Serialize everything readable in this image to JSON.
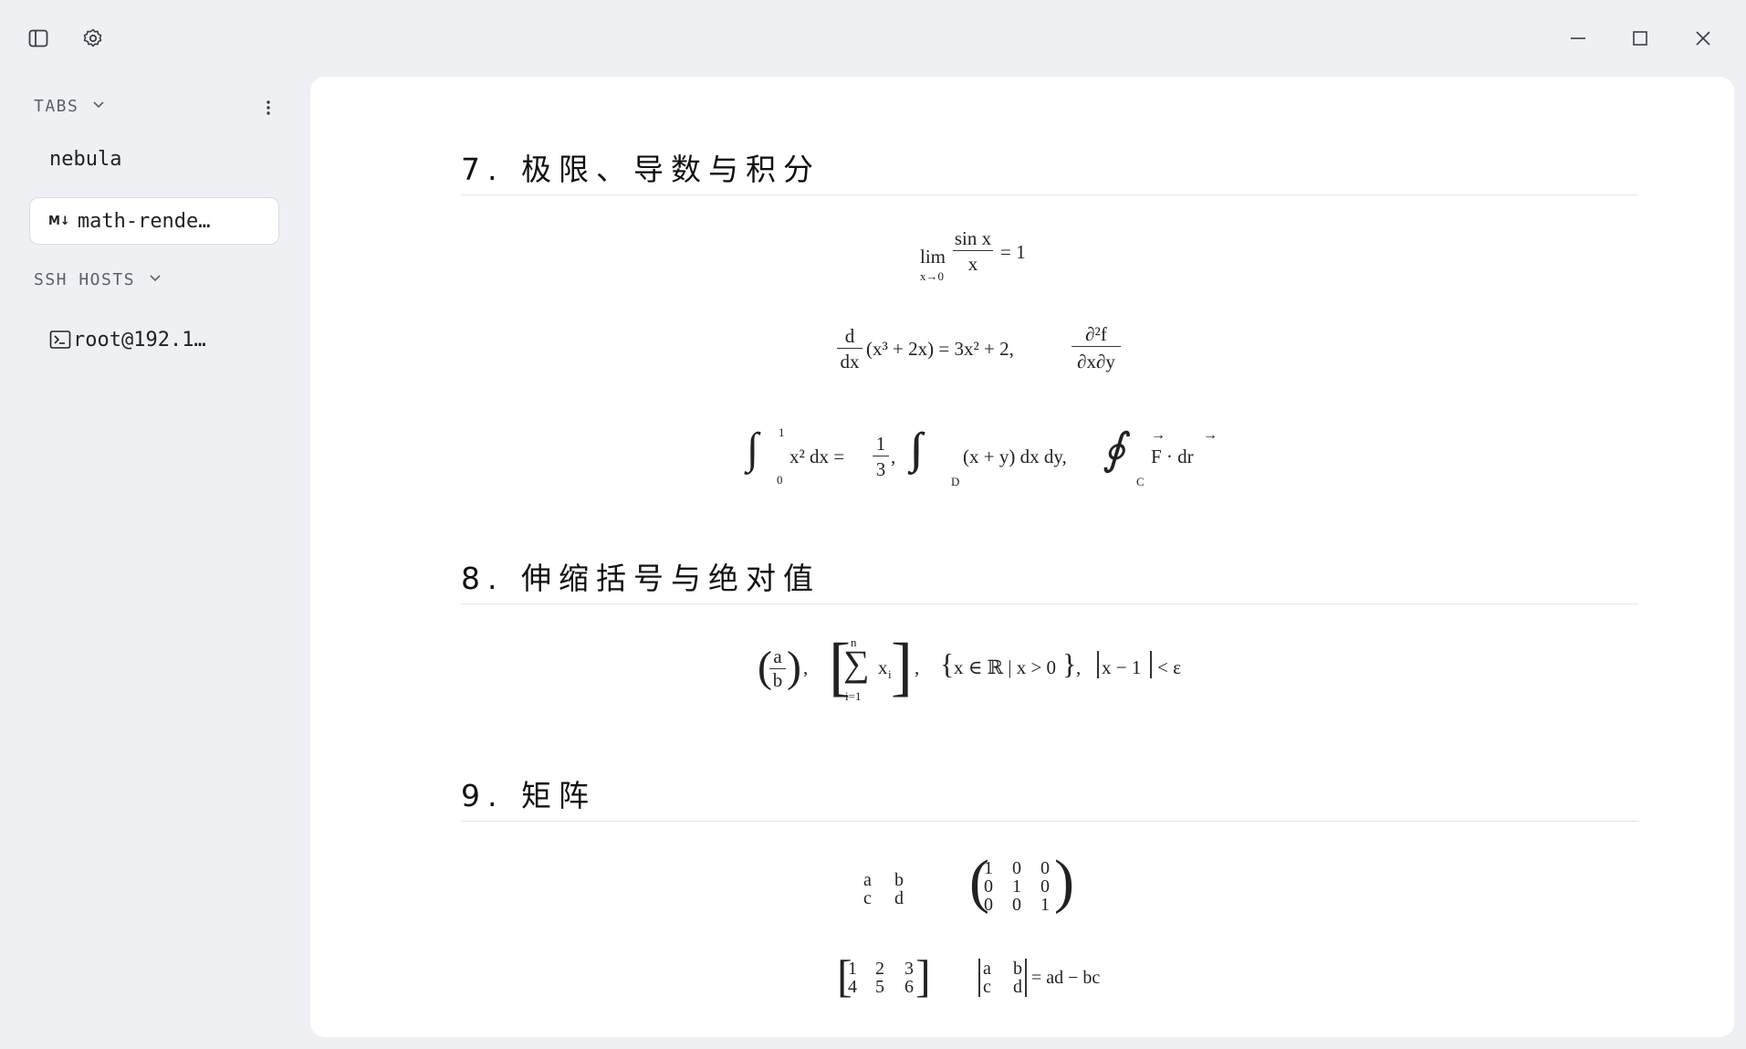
{
  "titlebar": {
    "icons": [
      "sidebar-toggle-icon",
      "gear-icon",
      "minimize-icon",
      "maximize-icon",
      "close-icon"
    ]
  },
  "sidebar": {
    "tabs_header": "TABS",
    "tabs": [
      {
        "label": "nebula",
        "active": false
      },
      {
        "label": "math-rende…",
        "active": true,
        "icon_text": "M↓"
      }
    ],
    "ssh_header": "SSH HOSTS",
    "ssh_hosts": [
      {
        "label": "root@192.1…"
      }
    ]
  },
  "document": {
    "sections": [
      {
        "heading": "7. 极限、导数与积分"
      },
      {
        "heading": "8. 伸缩括号与绝对值"
      },
      {
        "heading": "9. 矩阵"
      }
    ],
    "math": {
      "lim": "lim",
      "lim_sub": "x→0",
      "sinx": "sin x",
      "x": "x",
      "eq1": "= 1",
      "d": "d",
      "dx": "dx",
      "deriv_body": "(x³ + 2x) = 3x² + 2,",
      "partial_num": "∂²f",
      "partial_den": "∂x∂y",
      "int_up": "1",
      "int_low": "0",
      "int_body": "x² dx =",
      "one": "1",
      "three": "3",
      "comma": ",",
      "dbl_sub": "D",
      "dbl_body": "(x + y) dx dy,",
      "oint_sub": "C",
      "oint_body": "F · dr",
      "a": "a",
      "b": "b",
      "sum_up": "n",
      "sum_low": "i=1",
      "sum_body": "x",
      "sum_sub": "i",
      "set_body": "x ∈ ℝ | x > 0",
      "abs_body": "x − 1",
      "abs_tail": "< ε",
      "m1": [
        [
          "a",
          "b"
        ],
        [
          "c",
          "d"
        ]
      ],
      "m2": [
        [
          "1",
          "0",
          "0"
        ],
        [
          "0",
          "1",
          "0"
        ],
        [
          "0",
          "0",
          "1"
        ]
      ],
      "m3": [
        [
          "1",
          "2",
          "3"
        ],
        [
          "4",
          "5",
          "6"
        ]
      ],
      "m4": [
        [
          "a",
          "b"
        ],
        [
          "c",
          "d"
        ]
      ],
      "det_tail": "= ad − bc"
    }
  }
}
